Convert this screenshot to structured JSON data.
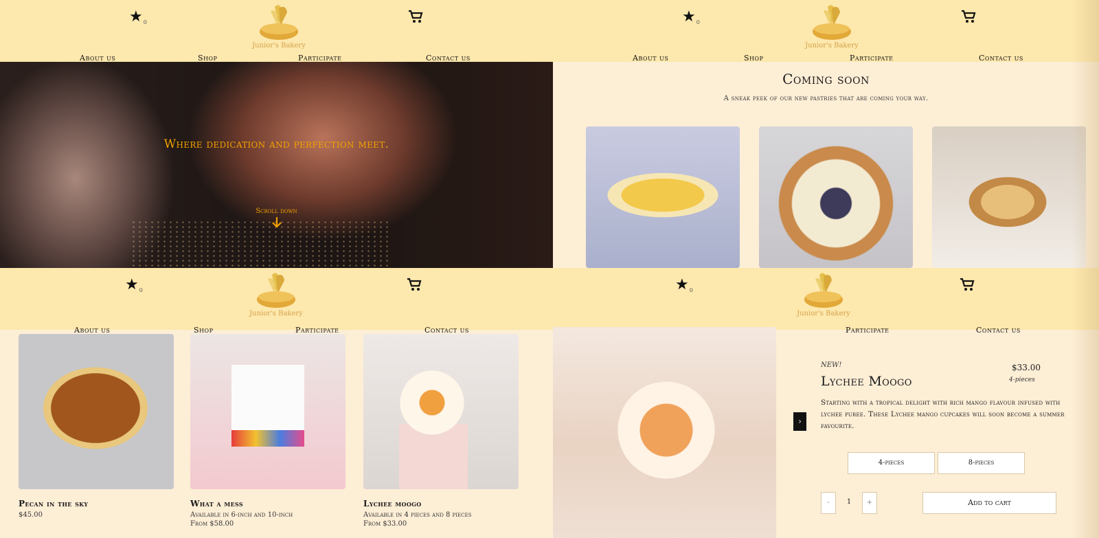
{
  "brand": {
    "logo_text": "Junior's Bakery",
    "accent": "#f2a200",
    "header_bg": "#fde8ad",
    "page_bg": "#fdeed6"
  },
  "header": {
    "favorites_count": "0",
    "nav": [
      "About us",
      "Shop",
      "Participate",
      "Contact us"
    ]
  },
  "hero": {
    "tagline": "Where dedication and perfection meet.",
    "scroll_label": "Scroll down"
  },
  "coming_soon": {
    "title": "Coming soon",
    "subtitle": "A sneak peek of our new pastries that are coming your way."
  },
  "shop": {
    "products": [
      {
        "name": "Pecan in the sky",
        "line1": "$45.00",
        "line2": ""
      },
      {
        "name": "What a mess",
        "line1": "Available in 6-inch and 10-inch",
        "line2": "From $58.00"
      },
      {
        "name": "Lychee moogo",
        "line1": "Available in 4 pieces and 8 pieces",
        "line2": "From $33.00"
      }
    ]
  },
  "product_detail": {
    "badge": "NEW!",
    "title": "Lychee Moogo",
    "price": "$33.00",
    "variant_note": "4-pieces",
    "description": "Starting with a tropical delight with rich mango flavour infused with lychee puree. These Lychee mango cupcakes will soon become a summer favourite.",
    "options": [
      "4-pieces",
      "8-pieces"
    ],
    "qty_minus": "-",
    "qty_value": "1",
    "qty_plus": "+",
    "add_to_cart": "Add to cart",
    "prev_icon": "‹",
    "next_icon": "›"
  }
}
